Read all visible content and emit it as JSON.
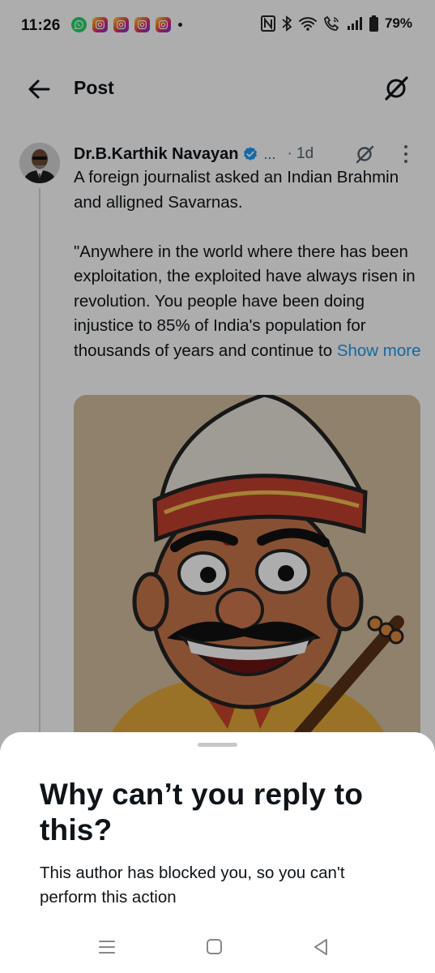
{
  "status_bar": {
    "time": "11:26",
    "notification_icons": [
      "whatsapp-icon",
      "instagram-icon",
      "instagram-icon",
      "instagram-icon",
      "instagram-icon"
    ],
    "battery": "79%"
  },
  "header": {
    "title": "Post"
  },
  "post": {
    "author": "Dr.B.Karthik Navayan",
    "handle_truncated": "...",
    "time": "· 1d",
    "text": "A foreign journalist asked an Indian Brahmin and alligned Savarnas.\n\n\"Anywhere in the world where there has been exploitation, the exploited have always risen in revolution. You people have been doing injustice to 85% of India's population for thousands of years and continue to ",
    "show_more": "Show more"
  },
  "sheet": {
    "title": "Why can’t you reply to this?",
    "body": "This author has blocked you, so you can't perform this action"
  },
  "colors": {
    "accent": "#1d9bf0",
    "text": "#0f1419",
    "secondary": "#536471"
  }
}
